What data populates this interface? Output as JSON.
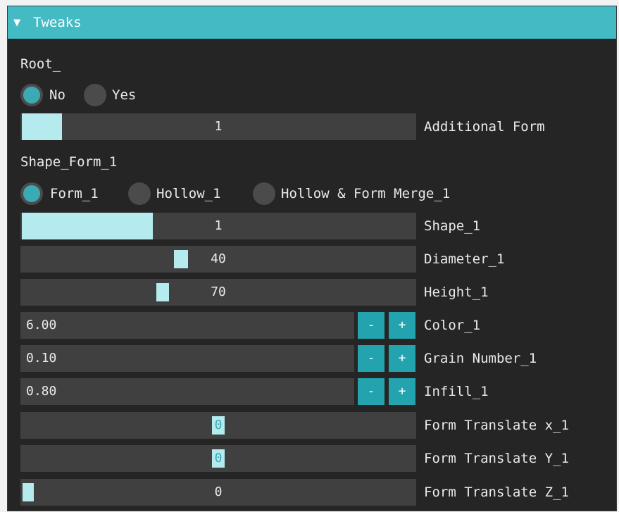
{
  "panel": {
    "title": "Tweaks",
    "collapse_arrow": "▼"
  },
  "root": {
    "heading": "Root_",
    "options": [
      "No",
      "Yes"
    ],
    "selected": "No",
    "additional_form": {
      "label": "Additional Form",
      "value": "1",
      "fraction": 0.1
    }
  },
  "shape_form": {
    "heading": "Shape_Form_1",
    "options": [
      "Form_1",
      "Hollow_1",
      "Hollow & Form Merge_1"
    ],
    "selected": "Form_1"
  },
  "sliders": [
    {
      "label": "Shape_1",
      "value": "1",
      "fraction": 0.33
    },
    {
      "label": "Diameter_1",
      "value": "40",
      "fraction": 0.41
    },
    {
      "label": "Height_1",
      "value": "70",
      "fraction": 0.36
    }
  ],
  "steppers": [
    {
      "label": "Color_1",
      "value": "6.00",
      "minus": "-",
      "plus": "+"
    },
    {
      "label": "Grain Number_1",
      "value": "0.10",
      "minus": "-",
      "plus": "+"
    },
    {
      "label": "Infill_1",
      "value": "0.80",
      "minus": "-",
      "plus": "+"
    }
  ],
  "translates": [
    {
      "label": "Form Translate x_1",
      "value": "0",
      "fraction": 0.5
    },
    {
      "label": "Form Translate Y_1",
      "value": "0",
      "fraction": 0.5
    },
    {
      "label": "Form Translate Z_1",
      "value": "0",
      "fraction": 0.0
    }
  ]
}
